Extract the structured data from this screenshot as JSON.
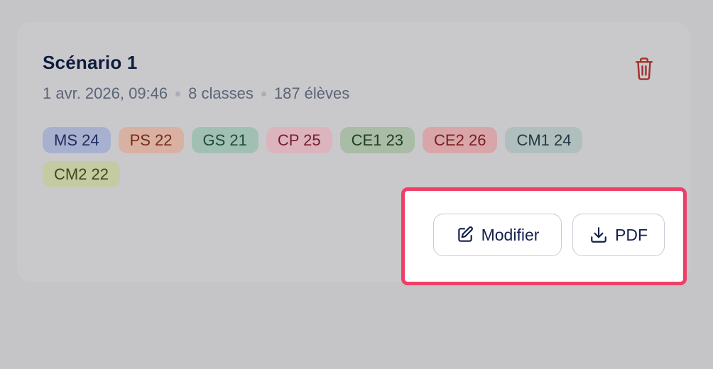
{
  "scenario": {
    "title": "Scénario 1",
    "date": "1 avr. 2026, 09:46",
    "classes": "8 classes",
    "students": "187 élèves",
    "delete_icon": "trash-icon",
    "tags": [
      {
        "label": "MS 24",
        "bg": "#a8b0cf",
        "fg": "#1e2b5e"
      },
      {
        "label": "PS 22",
        "bg": "#d8b1a2",
        "fg": "#7a2a14"
      },
      {
        "label": "GS 21",
        "bg": "#a1c0b3",
        "fg": "#1d4a3a"
      },
      {
        "label": "CP 25",
        "bg": "#dcb4bd",
        "fg": "#7a1a2d"
      },
      {
        "label": "CE1 23",
        "bg": "#a9bca6",
        "fg": "#1f3e1f"
      },
      {
        "label": "CE2 26",
        "bg": "#d8a6a8",
        "fg": "#7a1c20"
      },
      {
        "label": "CM1 24",
        "bg": "#b0bfbd",
        "fg": "#213a43"
      },
      {
        "label": "CM2 22",
        "bg": "#c4cba3",
        "fg": "#3d4a14"
      }
    ]
  },
  "actions": {
    "edit_label": "Modifier",
    "edit_icon": "pencil-icon",
    "pdf_label": "PDF",
    "pdf_icon": "download-icon"
  },
  "colors": {
    "highlight_border": "#ef3f68",
    "trash": "#a3302c"
  }
}
